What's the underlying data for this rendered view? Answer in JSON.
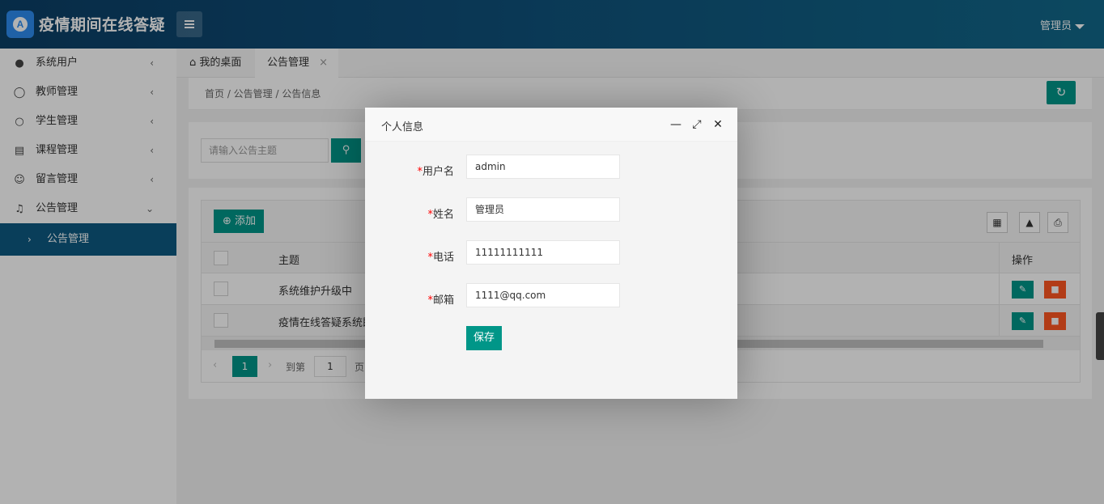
{
  "app": {
    "title": "疫情期间在线答疑",
    "logo_letter": "A"
  },
  "header": {
    "user_label": "管理员"
  },
  "sidebar": {
    "items": [
      {
        "label": "系统用户",
        "icon": "user-solid-icon",
        "arrow": "‹"
      },
      {
        "label": "教师管理",
        "icon": "user-circle-icon",
        "arrow": "‹"
      },
      {
        "label": "学生管理",
        "icon": "user-outline-icon",
        "arrow": "‹"
      },
      {
        "label": "课程管理",
        "icon": "book-icon",
        "arrow": "‹"
      },
      {
        "label": "留言管理",
        "icon": "message-icon",
        "arrow": "‹"
      },
      {
        "label": "公告管理",
        "icon": "bell-icon",
        "arrow": "⌄"
      }
    ],
    "sub_item": {
      "label": "公告管理"
    }
  },
  "tabs": [
    {
      "label": "我的桌面",
      "icon": "home-icon"
    },
    {
      "label": "公告管理",
      "close": "×"
    }
  ],
  "breadcrumb": {
    "text": "首页  /  公告管理  /  公告信息"
  },
  "search": {
    "placeholder": "请输入公告主题"
  },
  "table": {
    "add_label": "添加",
    "columns": [
      "主题",
      "操作"
    ],
    "rows": [
      {
        "subject": "系统维护升级中"
      },
      {
        "subject": "疫情在线答疑系统即"
      }
    ]
  },
  "pager": {
    "current": "1",
    "goto_label": "到第",
    "goto_value": "1",
    "page_unit": "页"
  },
  "modal": {
    "title": "个人信息",
    "fields": [
      {
        "label": "用户名",
        "value": "admin"
      },
      {
        "label": "姓名",
        "value": "管理员"
      },
      {
        "label": "电话",
        "value": "11111111111"
      },
      {
        "label": "邮箱",
        "value": "1111@qq.com"
      }
    ],
    "required_mark": "*",
    "save_label": "保存"
  },
  "colors": {
    "primary": "#009688",
    "danger": "#ff5722",
    "header": "#0f4e78",
    "sidebar_active": "#0d5a82"
  }
}
